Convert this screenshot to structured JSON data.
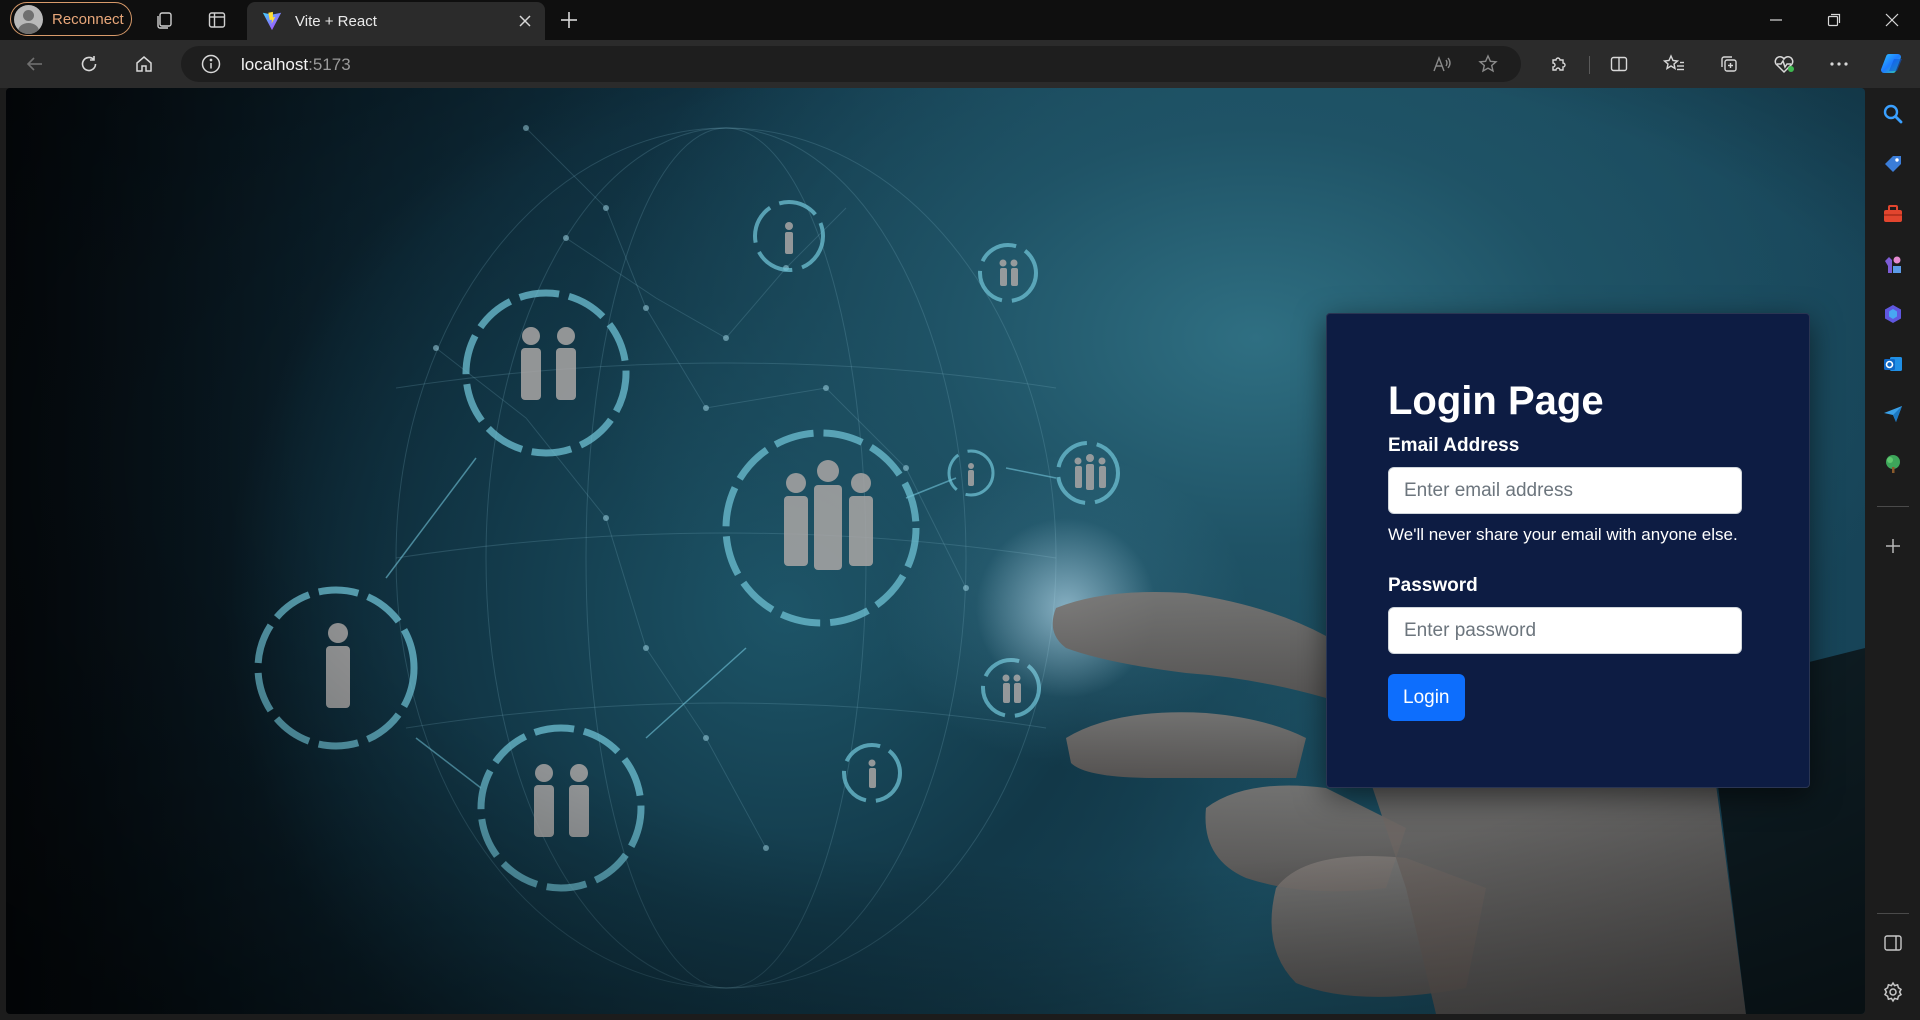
{
  "browser": {
    "profile": {
      "label": "Reconnect",
      "icon": "avatar-icon"
    },
    "tab": {
      "title": "Vite + React",
      "favicon": "vite-logo-icon"
    },
    "address": {
      "host": "localhost",
      "port": ":5173"
    },
    "toolbar_icons": [
      "read-aloud-icon",
      "favorite-star-icon",
      "extensions-icon",
      "split-screen-icon",
      "favorites-icon",
      "collections-icon",
      "browser-essentials-icon",
      "more-icon",
      "copilot-icon"
    ],
    "sidebar_icons": [
      "search-icon",
      "shopping-tag-icon",
      "tools-icon",
      "games-icon",
      "copilot-m365-icon",
      "outlook-icon",
      "send-icon",
      "tree-icon",
      "add-icon",
      "sidebar-toggle-icon",
      "settings-icon"
    ]
  },
  "login": {
    "title": "Login Page",
    "email_label": "Email Address",
    "email_placeholder": "Enter email address",
    "email_help": "We'll never share your email with anyone else.",
    "password_label": "Password",
    "password_placeholder": "Enter password",
    "submit_label": "Login"
  },
  "colors": {
    "card_bg": "#0d1c43",
    "button_bg": "#0d6efd",
    "profile_accent": "#e8a77a",
    "background_teal": "#1f5366"
  }
}
